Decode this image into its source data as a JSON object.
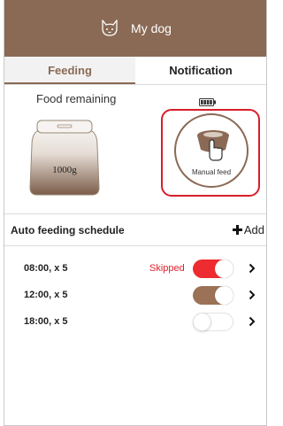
{
  "header": {
    "title": "My dog"
  },
  "tabs": [
    {
      "label": "Feeding",
      "active": true
    },
    {
      "label": "Notification",
      "active": false
    }
  ],
  "food": {
    "label": "Food remaining",
    "container_value": "1000g",
    "manual_feed_label": "Manual feed"
  },
  "schedule": {
    "title": "Auto feeding schedule",
    "add_label": "Add",
    "items": [
      {
        "time": "08:00, x 5",
        "status": "Skipped",
        "toggle": "on",
        "color": "#ee2b30"
      },
      {
        "time": "12:00, x 5",
        "status": "",
        "toggle": "on",
        "color": "#9c7256"
      },
      {
        "time": "18:00, x 5",
        "status": "",
        "toggle": "off",
        "color": "#ffffff"
      }
    ]
  },
  "colors": {
    "brand": "#8a6a55",
    "alert": "#d81e2a"
  },
  "icons": [
    "cat-icon",
    "battery-icon",
    "food-container-icon",
    "manual-feed-icon",
    "plus-icon",
    "chevron-right-icon"
  ]
}
